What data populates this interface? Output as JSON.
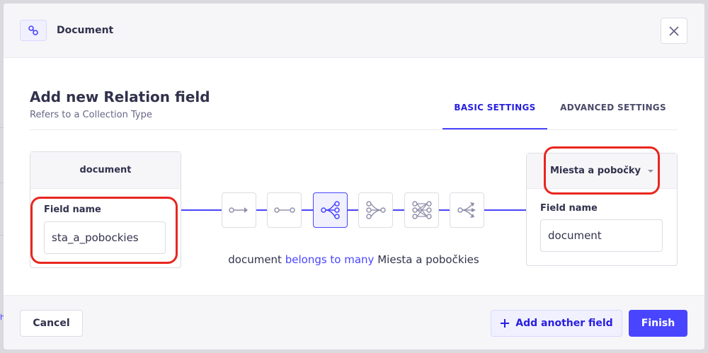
{
  "header": {
    "icon": "relation-link-icon",
    "title": "Document",
    "close_icon": "close-icon"
  },
  "form": {
    "title": "Add new Relation field",
    "subtitle": "Refers to a Collection Type"
  },
  "tabs": [
    {
      "label": "BASIC SETTINGS",
      "active": true
    },
    {
      "label": "ADVANCED SETTINGS",
      "active": false
    }
  ],
  "left_card": {
    "title": "document",
    "field_label": "Field name",
    "field_value": "sta_a_pobockies"
  },
  "right_card": {
    "target": "Miesta a pobočky",
    "field_label": "Field name",
    "field_value": "document"
  },
  "relation_types": [
    {
      "icon": "one-way-relation-icon",
      "active": false
    },
    {
      "icon": "one-to-one-relation-icon",
      "active": false
    },
    {
      "icon": "one-to-many-relation-icon",
      "active": true
    },
    {
      "icon": "many-to-one-relation-icon",
      "active": false
    },
    {
      "icon": "many-to-many-relation-icon",
      "active": false
    },
    {
      "icon": "many-way-relation-icon",
      "active": false
    }
  ],
  "relation_description": {
    "source": "document",
    "relation": "belongs to many",
    "target": "Miesta a pobočkies"
  },
  "footer": {
    "cancel_label": "Cancel",
    "add_label": "Add another field",
    "finish_label": "Finish"
  },
  "colors": {
    "primary": "#4945ff",
    "highlight": "#e8261e"
  },
  "backdrop": {
    "edge_glyph": "h"
  }
}
